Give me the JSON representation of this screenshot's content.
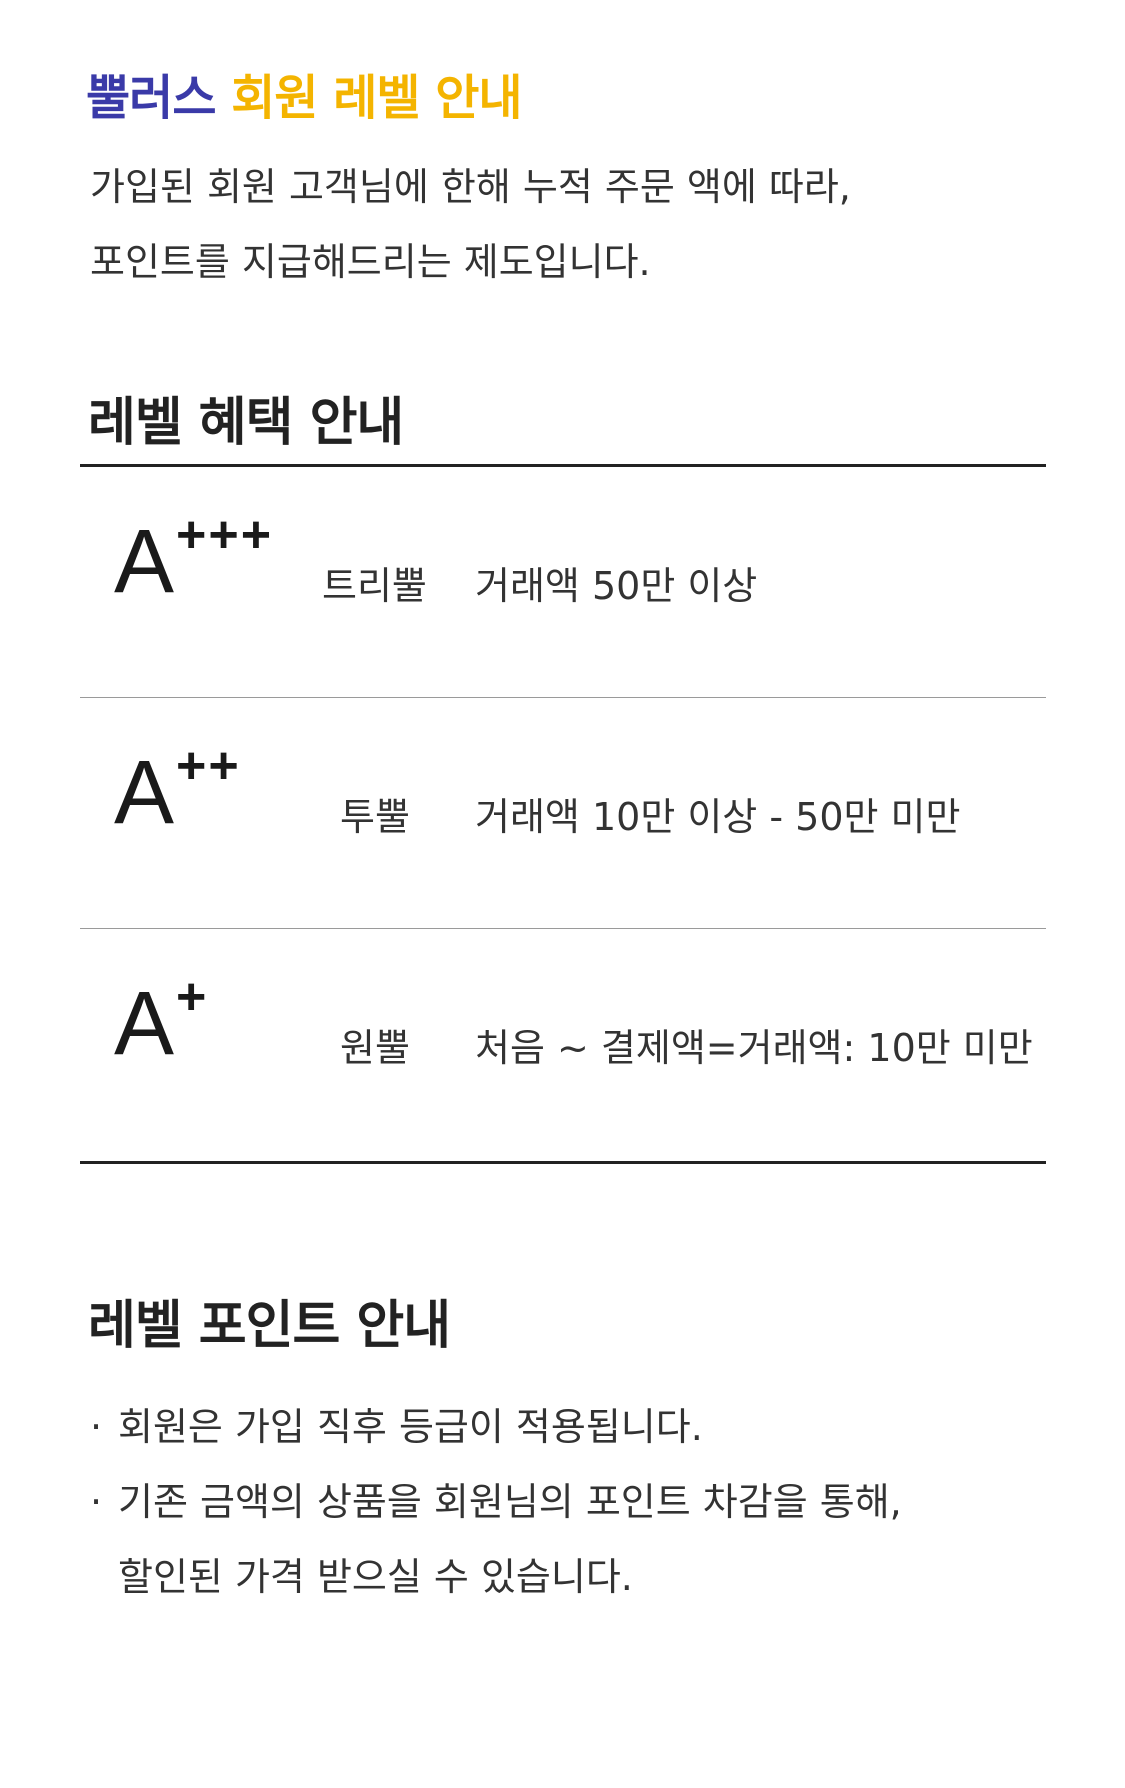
{
  "header": {
    "brand": "뿔러스",
    "title_rest": "회원 레벨 안내",
    "brand_color": "#3a3aa8",
    "accent_color": "#f4b400"
  },
  "intro": {
    "line1": "가입된 회원 고객님에 한해 누적 주문 액에 따라,",
    "line2": "포인트를 지급해드리는 제도입니다."
  },
  "benefits": {
    "title": "레벨 혜택 안내",
    "levels": [
      {
        "grade": "A",
        "plus": "+++",
        "name": "트리뿔",
        "condition": "거래액 50만 이상"
      },
      {
        "grade": "A",
        "plus": "++",
        "name": "투뿔",
        "condition": "거래액 10만 이상 - 50만 미만"
      },
      {
        "grade": "A",
        "plus": "+",
        "name": "원뿔",
        "condition": "처음 ~ 결제액=거래액: 10만 미만"
      }
    ]
  },
  "points": {
    "title": "레벨 포인트 안내",
    "bullet": "·",
    "notes": [
      "회원은 가입 직후 등급이 적용됩니다.",
      "기존 금액의 상품을 회원님의 포인트 차감을 통해,"
    ],
    "continuation": "할인된 가격 받으실 수 있습니다."
  }
}
